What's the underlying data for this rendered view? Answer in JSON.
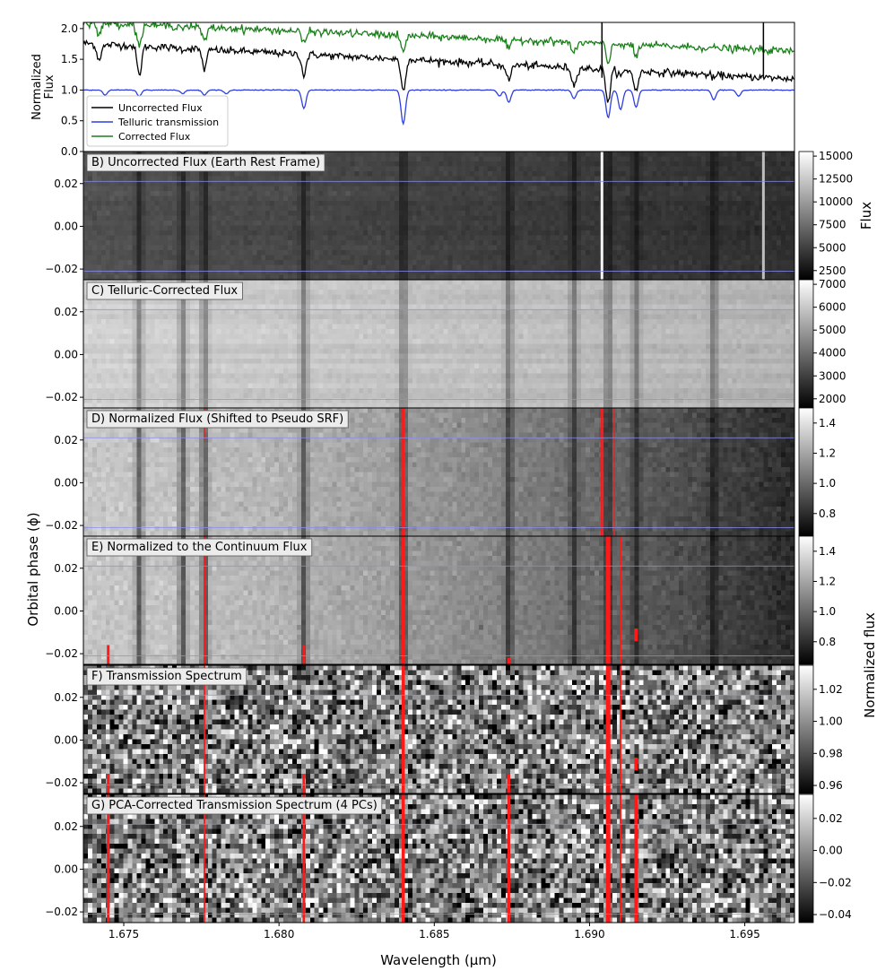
{
  "chart_data": {
    "type": "line+heatmap",
    "x_axis": {
      "label": "Wavelength (μm)",
      "xlim": [
        1.6737,
        1.6966
      ],
      "ticks": [
        1.675,
        1.68,
        1.685,
        1.69,
        1.695
      ],
      "tick_labels": [
        "1.675",
        "1.680",
        "1.685",
        "1.690",
        "1.695"
      ]
    },
    "top_panel": {
      "ylabel": "Normalized\nFlux",
      "ylim": [
        0.0,
        2.1
      ],
      "yticks": [
        0.0,
        0.5,
        1.0,
        1.5,
        2.0
      ],
      "ytick_labels": [
        "0.0",
        "0.5",
        "1.0",
        "1.5",
        "2.0"
      ],
      "series": [
        {
          "name": "Uncorrected Flux",
          "color": "#000000",
          "start": 1.76,
          "end": 1.18,
          "noise": 0.03
        },
        {
          "name": "Telluric transmission",
          "color": "#2f3fe0",
          "start": 1.0,
          "end": 1.0,
          "noise": 0.003
        },
        {
          "name": "Corrected Flux",
          "color": "#1a7f1a",
          "start": 2.1,
          "end": 1.63,
          "noise": 0.03
        }
      ],
      "telluric_lines": [
        {
          "x": 1.6744,
          "d": 0.08
        },
        {
          "x": 1.6755,
          "d": 0.1
        },
        {
          "x": 1.6769,
          "d": 0.06
        },
        {
          "x": 1.6776,
          "d": 0.08
        },
        {
          "x": 1.6783,
          "d": 0.06
        },
        {
          "x": 1.6808,
          "d": 0.3
        },
        {
          "x": 1.684,
          "d": 0.55
        },
        {
          "x": 1.6871,
          "d": 0.1
        },
        {
          "x": 1.6874,
          "d": 0.2
        },
        {
          "x": 1.6895,
          "d": 0.14
        },
        {
          "x": 1.6906,
          "d": 0.45
        },
        {
          "x": 1.691,
          "d": 0.32
        },
        {
          "x": 1.6915,
          "d": 0.28
        },
        {
          "x": 1.694,
          "d": 0.16
        },
        {
          "x": 1.6948,
          "d": 0.1
        }
      ],
      "stellar_lines": [
        {
          "x": 1.6742,
          "d": 0.25
        },
        {
          "x": 1.6755,
          "d": 0.45
        },
        {
          "x": 1.6776,
          "d": 0.3
        },
        {
          "x": 1.6808,
          "d": 0.25
        },
        {
          "x": 1.684,
          "d": 0.35
        },
        {
          "x": 1.6874,
          "d": 0.2
        },
        {
          "x": 1.6895,
          "d": 0.25
        },
        {
          "x": 1.6906,
          "d": 0.4
        },
        {
          "x": 1.6915,
          "d": 0.25
        }
      ]
    },
    "heatmap_y": {
      "label": "Orbital phase (ϕ)",
      "ylim": [
        -0.025,
        0.035
      ],
      "yticks": [
        0.02,
        0.0,
        -0.02
      ],
      "ytick_labels": [
        "0.02",
        "0.00",
        "−0.02"
      ],
      "transit_lines_phase": [
        0.021,
        -0.021
      ]
    },
    "panels": [
      {
        "label": "B) Uncorrected Flux (Earth Rest Frame)",
        "mode": "raw",
        "cbar_ticks": [
          2500,
          5000,
          7500,
          10000,
          12500,
          15000
        ],
        "cbar_tick_labels": [
          "2500",
          "5000",
          "7500",
          "10000",
          "12500",
          "15000"
        ],
        "cbar_range": [
          1500,
          15500
        ],
        "top_tick_label": "0.0"
      },
      {
        "label": "C) Telluric-Corrected Flux",
        "mode": "corrected",
        "cbar_ticks": [
          2000,
          3000,
          4000,
          5000,
          6000,
          7000
        ],
        "cbar_tick_labels": [
          "2000",
          "3000",
          "4000",
          "5000",
          "6000",
          "7000"
        ],
        "cbar_range": [
          1600,
          7200
        ]
      },
      {
        "label": "D) Normalized Flux (Shifted to Pseudo SRF)",
        "mode": "normalized",
        "cbar_ticks": [
          0.8,
          1.0,
          1.2,
          1.4
        ],
        "cbar_tick_labels": [
          "0.8",
          "1.0",
          "1.2",
          "1.4"
        ],
        "cbar_range": [
          0.65,
          1.5
        ]
      },
      {
        "label": "E) Normalized to the Continuum Flux",
        "mode": "continuum",
        "cbar_ticks": [
          0.8,
          1.0,
          1.2,
          1.4
        ],
        "cbar_tick_labels": [
          "0.8",
          "1.0",
          "1.2",
          "1.4"
        ],
        "cbar_range": [
          0.65,
          1.5
        ]
      },
      {
        "label": "F) Transmission Spectrum",
        "mode": "noise",
        "cbar_ticks": [
          0.96,
          0.98,
          1.0,
          1.02
        ],
        "cbar_tick_labels": [
          "0.96",
          "0.98",
          "1.00",
          "1.02"
        ],
        "cbar_range": [
          0.955,
          1.035
        ]
      },
      {
        "label": "G) PCA-Corrected Transmission Spectrum (4 PCs)",
        "mode": "noise",
        "cbar_ticks": [
          -0.04,
          -0.02,
          0.0,
          0.02
        ],
        "cbar_tick_labels": [
          "−0.04",
          "−0.02",
          "0.00",
          "0.02"
        ],
        "cbar_range": [
          -0.045,
          0.035
        ]
      }
    ],
    "colorbar_labels": [
      {
        "text": "Flux",
        "panels": [
          0
        ]
      },
      {
        "text": "Normalized flux",
        "panels": [
          2,
          3,
          4,
          5
        ]
      }
    ],
    "colors": {
      "mask": "#ff1a1a",
      "transit_line": "#8a8cf0",
      "panel_label_bg": "#ececec"
    }
  }
}
